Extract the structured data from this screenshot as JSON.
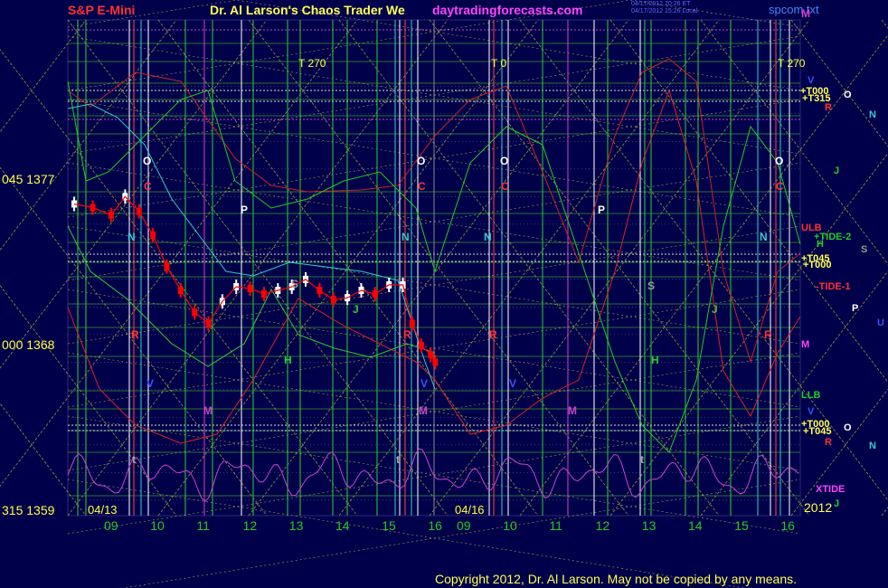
{
  "header": {
    "instrument": "S&P E-Mini",
    "title": "Dr. Al Larson's Chaos Trader We",
    "site": "daytradingforecasts.com",
    "stamp_line1": "04/17/2012 20:26 ET",
    "stamp_line2": "04/17/2012 15:26 Local",
    "file": "spcom.txt",
    "corner_label": "M"
  },
  "footer": {
    "copyright": "Copyright 2012, Dr. Al Larson. May not be copied by any means."
  },
  "colors": {
    "background": "#00004a",
    "grid": "#3a3a8a",
    "price": "#ff0000",
    "price_up": "#ffffff",
    "ma_cyan": "#33cccc",
    "ma_green": "#33cc33",
    "band_red": "#cc2222",
    "tide_green": "#22cc22",
    "tide_red": "#dd2222",
    "xtide": "#cc44cc",
    "moving_lines": "#cccc44",
    "time_label": "#22cc22",
    "axis_label": "#ffff44"
  },
  "chart_data": {
    "type": "line",
    "title": "S&P E-Mini",
    "y_ticks": [
      {
        "label": "045 1377",
        "value": 1377
      },
      {
        "label": "000 1368",
        "value": 1368
      },
      {
        "label": "315 1359",
        "value": 1359
      }
    ],
    "ylim": [
      1359,
      1377
    ],
    "x_ticks": [
      "09",
      "10",
      "11",
      "12",
      "13",
      "14",
      "15",
      "16",
      "09",
      "10",
      "11",
      "12",
      "13",
      "14",
      "15",
      "16"
    ],
    "date_labels": [
      "04/13",
      "04/16",
      "2012"
    ],
    "turn_labels": [
      "T 270",
      "T 0",
      "T 270"
    ],
    "series": [
      {
        "name": "price",
        "x": [
          8.2,
          8.6,
          9.0,
          9.3,
          9.6,
          9.9,
          10.2,
          10.5,
          10.8,
          11.1,
          11.4,
          11.7,
          12.0,
          12.3,
          12.6,
          12.9,
          13.2,
          13.5,
          13.8,
          14.1,
          14.4,
          14.7,
          15.0,
          15.3,
          15.5,
          15.7,
          15.9,
          16.0
        ],
        "values": [
          1375.6,
          1375.4,
          1375.0,
          1376.0,
          1375.2,
          1373.9,
          1372.2,
          1370.9,
          1369.7,
          1369.1,
          1370.3,
          1371.1,
          1371.0,
          1370.7,
          1370.9,
          1371.1,
          1371.5,
          1370.9,
          1370.4,
          1370.5,
          1370.9,
          1370.7,
          1371.2,
          1371.2,
          1369.1,
          1367.9,
          1367.4,
          1367.0
        ]
      }
    ],
    "grid": true
  },
  "chart_labels": {
    "planet_letters": [
      {
        "t": "O"
      },
      {
        "t": "C"
      },
      {
        "t": "N"
      },
      {
        "t": "R"
      },
      {
        "t": "V"
      },
      {
        "t": "M"
      },
      {
        "t": "P"
      },
      {
        "t": "S"
      },
      {
        "t": "J"
      },
      {
        "t": "H"
      },
      {
        "t": "t"
      },
      {
        "t": "O"
      },
      {
        "t": "C"
      },
      {
        "t": "N"
      },
      {
        "t": "R"
      },
      {
        "t": "V"
      },
      {
        "t": "M"
      },
      {
        "t": "P"
      },
      {
        "t": "S"
      },
      {
        "t": "J"
      },
      {
        "t": "H"
      },
      {
        "t": "t"
      },
      {
        "t": "O"
      },
      {
        "t": "C"
      },
      {
        "t": "N"
      },
      {
        "t": "R"
      },
      {
        "t": "V"
      },
      {
        "t": "M"
      },
      {
        "t": "O"
      },
      {
        "t": "C"
      },
      {
        "t": "N"
      },
      {
        "t": "R"
      },
      {
        "t": "t"
      }
    ],
    "right_labels": [
      {
        "t": "V"
      },
      {
        "t": "+T000"
      },
      {
        "t": "+T315"
      },
      {
        "t": "O"
      },
      {
        "t": "R"
      },
      {
        "t": "N"
      },
      {
        "t": "J"
      },
      {
        "t": "ULB"
      },
      {
        "t": "+TIDE-2"
      },
      {
        "t": "H"
      },
      {
        "t": "S"
      },
      {
        "t": "+T045"
      },
      {
        "t": "+T000"
      },
      {
        "t": "-TIDE-1"
      },
      {
        "t": "P"
      },
      {
        "t": "U"
      },
      {
        "t": "M"
      },
      {
        "t": "LLB"
      },
      {
        "t": "V"
      },
      {
        "t": "+T000"
      },
      {
        "t": "+T045"
      },
      {
        "t": "O"
      },
      {
        "t": "R"
      },
      {
        "t": "N"
      },
      {
        "t": "XTIDE"
      },
      {
        "t": "J"
      }
    ]
  }
}
